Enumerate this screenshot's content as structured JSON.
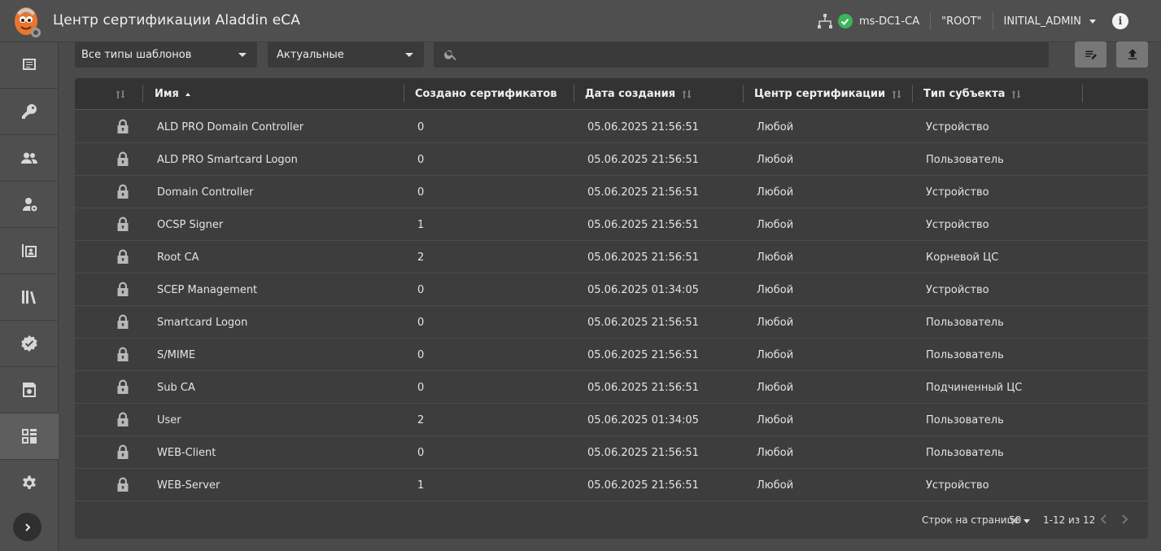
{
  "header": {
    "title": "Центр сертификации Aladdin eCA",
    "ca_name": "ms-DC1-CA",
    "root_label": "\"ROOT\"",
    "user": "INITIAL_ADMIN"
  },
  "sidebar": {
    "items": [
      {
        "name": "sidebar-item-dashboard",
        "icon": "monitor-icon"
      },
      {
        "name": "sidebar-item-keys",
        "icon": "key-icon"
      },
      {
        "name": "sidebar-item-users",
        "icon": "users-icon"
      },
      {
        "name": "sidebar-item-administrators",
        "icon": "admin-icon"
      },
      {
        "name": "sidebar-item-requests",
        "icon": "badge-icon"
      },
      {
        "name": "sidebar-item-library",
        "icon": "library-icon"
      },
      {
        "name": "sidebar-item-certificates",
        "icon": "verified-icon"
      },
      {
        "name": "sidebar-item-revocation",
        "icon": "certificate-icon"
      },
      {
        "name": "sidebar-item-templates",
        "icon": "templates-icon",
        "active": true
      },
      {
        "name": "sidebar-item-settings",
        "icon": "gear-icon"
      }
    ]
  },
  "toolbar": {
    "template_type": "Все типы шаблонов",
    "status_filter": "Актуальные",
    "search_placeholder": ""
  },
  "table": {
    "columns": {
      "name": "Имя",
      "issued": "Создано сертификатов",
      "created": "Дата создания",
      "ca": "Центр сертификации",
      "subject_type": "Тип субъекта"
    },
    "rows": [
      {
        "name": "ALD PRO Domain Controller",
        "issued": "0",
        "created": "05.06.2025 21:56:51",
        "ca": "Любой",
        "subject_type": "Устройство"
      },
      {
        "name": "ALD PRO Smartcard Logon",
        "issued": "0",
        "created": "05.06.2025 21:56:51",
        "ca": "Любой",
        "subject_type": "Пользователь"
      },
      {
        "name": "Domain Controller",
        "issued": "0",
        "created": "05.06.2025 21:56:51",
        "ca": "Любой",
        "subject_type": "Устройство"
      },
      {
        "name": "OCSP Signer",
        "issued": "1",
        "created": "05.06.2025 21:56:51",
        "ca": "Любой",
        "subject_type": "Устройство"
      },
      {
        "name": "Root CA",
        "issued": "2",
        "created": "05.06.2025 21:56:51",
        "ca": "Любой",
        "subject_type": "Корневой ЦС"
      },
      {
        "name": "SCEP Management",
        "issued": "0",
        "created": "05.06.2025 01:34:05",
        "ca": "Любой",
        "subject_type": "Устройство"
      },
      {
        "name": "Smartcard Logon",
        "issued": "0",
        "created": "05.06.2025 21:56:51",
        "ca": "Любой",
        "subject_type": "Пользователь"
      },
      {
        "name": "S/MIME",
        "issued": "0",
        "created": "05.06.2025 21:56:51",
        "ca": "Любой",
        "subject_type": "Пользователь"
      },
      {
        "name": "Sub CA",
        "issued": "0",
        "created": "05.06.2025 21:56:51",
        "ca": "Любой",
        "subject_type": "Подчиненный ЦС"
      },
      {
        "name": "User",
        "issued": "2",
        "created": "05.06.2025 01:34:05",
        "ca": "Любой",
        "subject_type": "Пользователь"
      },
      {
        "name": "WEB-Client",
        "issued": "0",
        "created": "05.06.2025 21:56:51",
        "ca": "Любой",
        "subject_type": "Пользователь"
      },
      {
        "name": "WEB-Server",
        "issued": "1",
        "created": "05.06.2025 21:56:51",
        "ca": "Любой",
        "subject_type": "Устройство"
      }
    ]
  },
  "pagination": {
    "rows_per_page_label": "Строк на странице",
    "rows_per_page": "50",
    "range": "1-12 из 12"
  },
  "colors": {
    "status_ok": "#3cb55a",
    "logo_orange": "#e8772e"
  }
}
